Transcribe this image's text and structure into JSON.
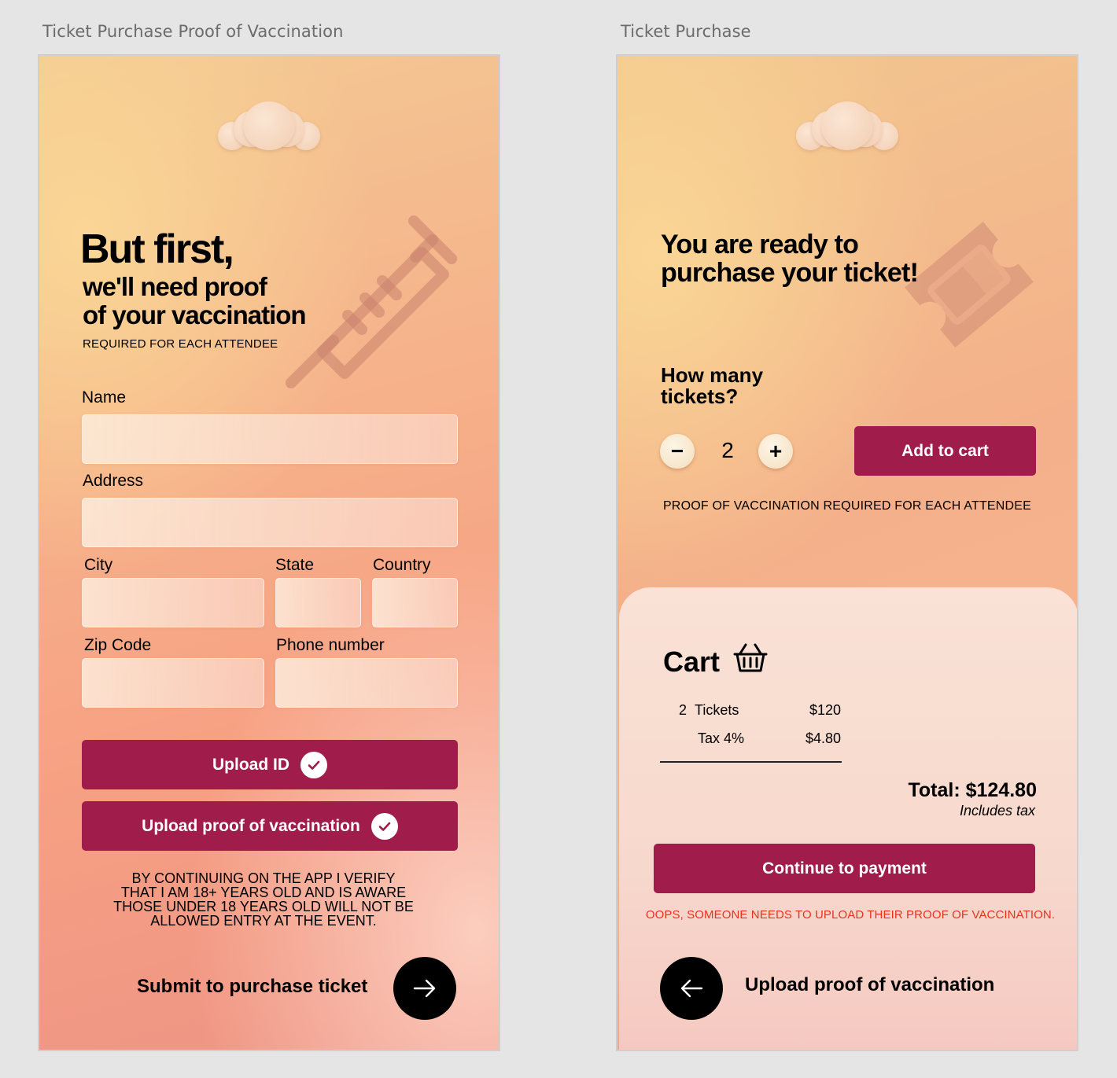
{
  "frames": [
    {
      "label": "Ticket Purchase Proof of Vaccination",
      "heading_big": "But first,",
      "heading_line1": "we'll need proof",
      "heading_line2": "of your vaccination",
      "subheading": "REQUIRED FOR EACH ATTENDEE",
      "fields": {
        "name": {
          "label": "Name",
          "value": ""
        },
        "address": {
          "label": "Address",
          "value": ""
        },
        "city": {
          "label": "City",
          "value": ""
        },
        "state": {
          "label": "State",
          "value": ""
        },
        "country": {
          "label": "Country",
          "value": ""
        },
        "zip": {
          "label": "Zip Code",
          "value": ""
        },
        "phone": {
          "label": "Phone number",
          "value": ""
        }
      },
      "upload_id_label": "Upload ID",
      "upload_vax_label": "Upload proof of vaccination",
      "disclaimer": [
        "BY CONTINUING ON THE APP I VERIFY",
        "THAT I AM 18+ YEARS OLD AND IS AWARE",
        "THOSE UNDER 18 YEARS OLD WILL NOT BE",
        "ALLOWED ENTRY AT THE EVENT."
      ],
      "submit_label": "Submit to purchase ticket",
      "icons": {
        "logo": "cloud-logo-icon",
        "background": "syringe-icon",
        "check": "check-icon",
        "next": "arrow-right-icon"
      }
    },
    {
      "label": "Ticket Purchase",
      "heading_line1": "You are ready to",
      "heading_line2": "purchase your ticket!",
      "question_line1": "How many",
      "question_line2": "tickets?",
      "quantity": "2",
      "minus": "−",
      "plus": "+",
      "add_to_cart_label": "Add to cart",
      "proof_note": "PROOF OF VACCINATION REQUIRED FOR EACH ATTENDEE",
      "cart": {
        "title": "Cart",
        "items": [
          {
            "qty": "2",
            "name": "Tickets",
            "price": "$120"
          },
          {
            "qty": "",
            "name": "Tax 4%",
            "price": "$4.80"
          }
        ],
        "total": "Total: $124.80",
        "includes_tax": "Includes tax"
      },
      "continue_label": "Continue to payment",
      "error": "OOPS, SOMEONE NEEDS TO UPLOAD THEIR PROOF OF VACCINATION.",
      "back_upload_label": "Upload proof of vaccination",
      "icons": {
        "logo": "cloud-logo-icon",
        "background": "ticket-icon",
        "cart": "basket-icon",
        "back": "arrow-left-icon"
      }
    }
  ],
  "colors": {
    "accent": "#a01d4b",
    "error": "#e8321d",
    "text": "#000000"
  }
}
